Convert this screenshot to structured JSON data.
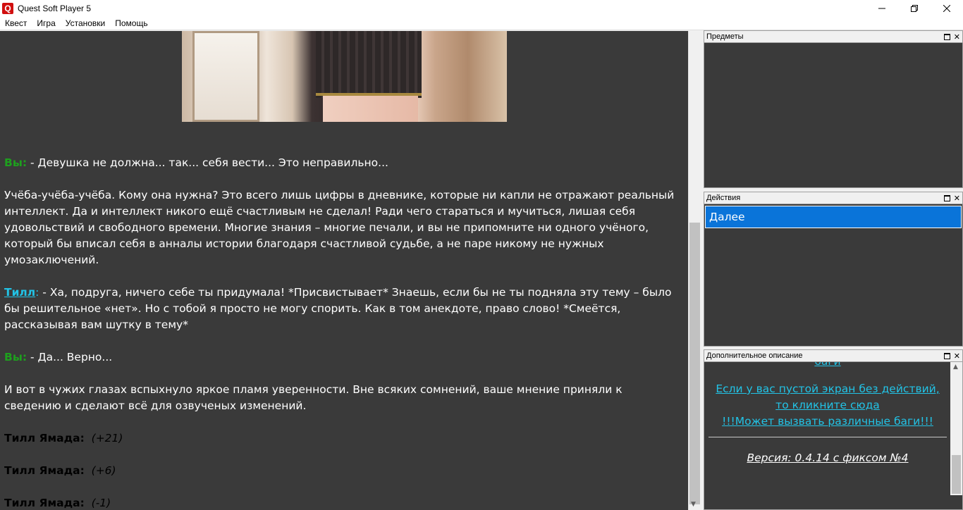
{
  "window": {
    "title": "Quest Soft Player 5",
    "icon_letter": "Q"
  },
  "menu": [
    "Квест",
    "Игра",
    "Установки",
    "Помощь"
  ],
  "story": {
    "you_label": "Вы:",
    "till_label": "Тилл",
    "till_tail": ":",
    "line1": " - Девушка не должна... так... себя вести... Это неправильно...",
    "paragraph2": "Учёба-учёба-учёба. Кому она нужна? Это всего лишь цифры в дневнике, которые ни капли не отражают реальный интеллект. Да и интеллект никого ещё счастливым не сделал! Ради чего стараться и мучиться, лишая себя удовольствий и свободного времени. Многие знания – многие печали, и вы не припомните ни одного учёного, который бы вписал себя в анналы истории благодаря счастливой судьбе, а не паре никому не нужных умозаключений.",
    "line3": " - Ха, подруга, ничего себе ты придумала! *Присвистывает* Знаешь, если бы не ты подняла эту тему – было бы решительное «нет». Но с тобой я просто не могу спорить. Как в том анекдоте, право слово! *Смеётся, рассказывая вам шутку в тему*",
    "line4": " - Да... Верно...",
    "paragraph5": "И вот в чужих глазах вспыхнуло яркое пламя уверенности. Вне всяких сомнений, ваше мнение приняли к сведению и сделают всё для озвученых изменений.",
    "stat_name": "Тилл Ямада",
    "stat_values": [
      "(+21)",
      "(+6)",
      "(-1)"
    ]
  },
  "panels": {
    "items": {
      "title": "Предметы"
    },
    "actions": {
      "title": "Действия",
      "list": [
        "Далее"
      ]
    },
    "extra": {
      "title": "Дополнительное описание",
      "cut_top_link": "баги",
      "empty_screen_link": "Если у вас пустой экран без действий, то кликните сюда",
      "bugs_warning": "!!!Может вызвать различные баги!!!",
      "version": "Версия: 0.4.14 с фиксом №4"
    }
  },
  "colors": {
    "you": "#1ea01e",
    "till": "#22c3e6",
    "selected_action": "#0a74d9",
    "background": "#3a3a3a"
  }
}
